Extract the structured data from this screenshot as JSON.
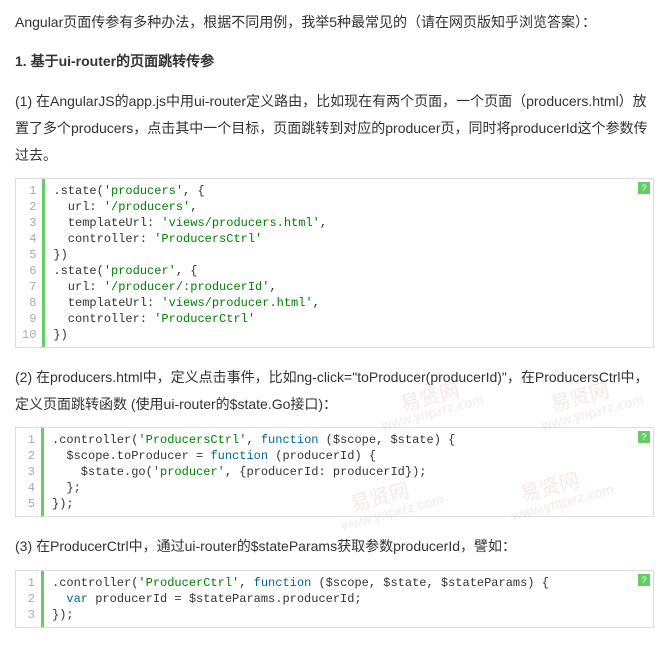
{
  "intro": "Angular页面传参有多种办法，根据不同用例，我举5种最常见的（请在网页版知乎浏览答案）：",
  "heading": "1. 基于ui-router的页面跳转传参",
  "para1": "(1) 在AngularJS的app.js中用ui-router定义路由，比如现在有两个页面，一个页面（producers.html）放置了多个producers，点击其中一个目标，页面跳转到对应的producer页，同时将producerId这个参数传过去。",
  "code1": {
    "lines": [
      [
        {
          "t": ".state(",
          "c": "plain"
        },
        {
          "t": "'producers'",
          "c": "str"
        },
        {
          "t": ", {",
          "c": "plain"
        }
      ],
      [
        {
          "t": "  url: ",
          "c": "plain"
        },
        {
          "t": "'/producers'",
          "c": "str"
        },
        {
          "t": ",",
          "c": "plain"
        }
      ],
      [
        {
          "t": "  templateUrl: ",
          "c": "plain"
        },
        {
          "t": "'views/producers.html'",
          "c": "str"
        },
        {
          "t": ",",
          "c": "plain"
        }
      ],
      [
        {
          "t": "  controller: ",
          "c": "plain"
        },
        {
          "t": "'ProducersCtrl'",
          "c": "str"
        }
      ],
      [
        {
          "t": "})",
          "c": "plain"
        }
      ],
      [
        {
          "t": ".state(",
          "c": "plain"
        },
        {
          "t": "'producer'",
          "c": "str"
        },
        {
          "t": ", {",
          "c": "plain"
        }
      ],
      [
        {
          "t": "  url: ",
          "c": "plain"
        },
        {
          "t": "'/producer/:producerId'",
          "c": "str"
        },
        {
          "t": ",",
          "c": "plain"
        }
      ],
      [
        {
          "t": "  templateUrl: ",
          "c": "plain"
        },
        {
          "t": "'views/producer.html'",
          "c": "str"
        },
        {
          "t": ",",
          "c": "plain"
        }
      ],
      [
        {
          "t": "  controller: ",
          "c": "plain"
        },
        {
          "t": "'ProducerCtrl'",
          "c": "str"
        }
      ],
      [
        {
          "t": "})",
          "c": "plain"
        }
      ]
    ]
  },
  "para2": "(2) 在producers.html中，定义点击事件，比如ng-click=\"toProducer(producerId)\"，在ProducersCtrl中，定义页面跳转函数 (使用ui-router的$state.Go接口)：",
  "code2": {
    "lines": [
      [
        {
          "t": ".controller(",
          "c": "plain"
        },
        {
          "t": "'ProducersCtrl'",
          "c": "str"
        },
        {
          "t": ", ",
          "c": "plain"
        },
        {
          "t": "function",
          "c": "kw"
        },
        {
          "t": " ($scope, $state) {",
          "c": "plain"
        }
      ],
      [
        {
          "t": "  $scope.toProducer = ",
          "c": "plain"
        },
        {
          "t": "function",
          "c": "kw"
        },
        {
          "t": " (producerId) {",
          "c": "plain"
        }
      ],
      [
        {
          "t": "    $state.go(",
          "c": "plain"
        },
        {
          "t": "'producer'",
          "c": "str"
        },
        {
          "t": ", {producerId: producerId});",
          "c": "plain"
        }
      ],
      [
        {
          "t": "  };",
          "c": "plain"
        }
      ],
      [
        {
          "t": "});",
          "c": "plain"
        }
      ]
    ]
  },
  "para3": "(3) 在ProducerCtrl中，通过ui-router的$stateParams获取参数producerId，譬如：",
  "code3": {
    "lines": [
      [
        {
          "t": ".controller(",
          "c": "plain"
        },
        {
          "t": "'ProducerCtrl'",
          "c": "str"
        },
        {
          "t": ", ",
          "c": "plain"
        },
        {
          "t": "function",
          "c": "kw"
        },
        {
          "t": " ($scope, $state, $stateParams) {",
          "c": "plain"
        }
      ],
      [
        {
          "t": "  ",
          "c": "plain"
        },
        {
          "t": "var",
          "c": "kw"
        },
        {
          "t": " producerId = $stateParams.producerId;",
          "c": "plain"
        }
      ],
      [
        {
          "t": "});",
          "c": "plain"
        }
      ]
    ]
  },
  "qmark": "?",
  "watermark_cn": "易贤网",
  "watermark_url": "www.ynpxrz.com"
}
